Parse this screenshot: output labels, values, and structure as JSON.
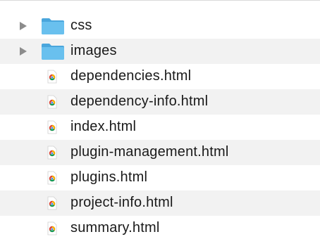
{
  "files": [
    {
      "name": "css",
      "type": "folder",
      "icon": "folder-icon",
      "expanded": false
    },
    {
      "name": "images",
      "type": "folder",
      "icon": "folder-icon",
      "expanded": false
    },
    {
      "name": "dependencies.html",
      "type": "html",
      "icon": "chrome-html-file-icon"
    },
    {
      "name": "dependency-info.html",
      "type": "html",
      "icon": "chrome-html-file-icon"
    },
    {
      "name": "index.html",
      "type": "html",
      "icon": "chrome-html-file-icon"
    },
    {
      "name": "plugin-management.html",
      "type": "html",
      "icon": "chrome-html-file-icon"
    },
    {
      "name": "plugins.html",
      "type": "html",
      "icon": "chrome-html-file-icon"
    },
    {
      "name": "project-info.html",
      "type": "html",
      "icon": "chrome-html-file-icon"
    },
    {
      "name": "summary.html",
      "type": "html",
      "icon": "chrome-html-file-icon"
    }
  ],
  "colors": {
    "folder": "#5db7ea",
    "folder_tab": "#4aa6dc",
    "stripe": "#f2f2f2",
    "disclosure": "#8c8c8c",
    "chrome_red": "#db4437",
    "chrome_yellow": "#f4b400",
    "chrome_green": "#0f9d58",
    "chrome_blue": "#4285f4"
  }
}
